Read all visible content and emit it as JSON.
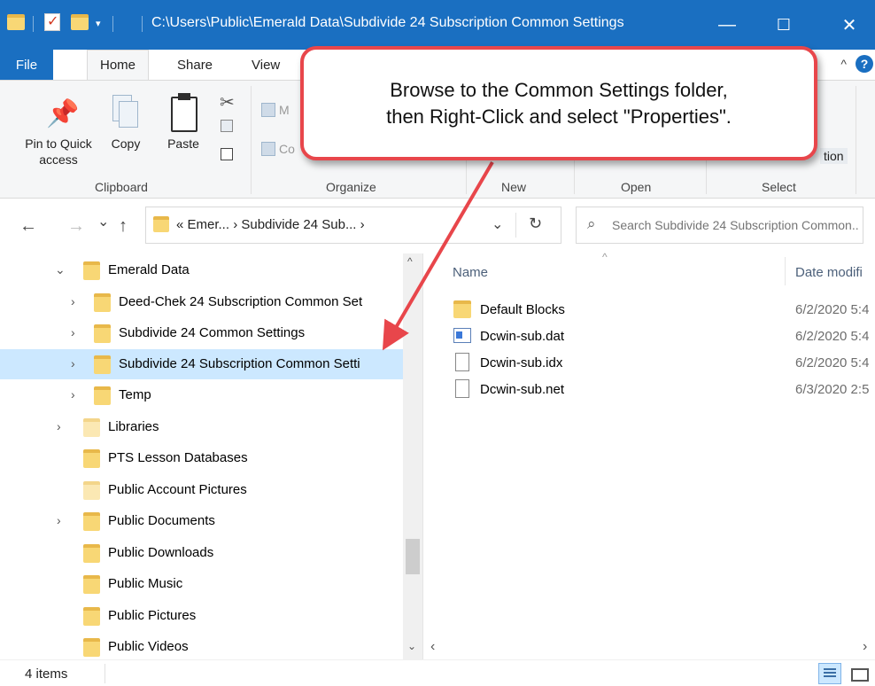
{
  "window": {
    "title": "C:\\Users\\Public\\Emerald Data\\Subdivide 24 Subscription Common Settings",
    "minimize_glyph": "—",
    "maximize_glyph": "☐",
    "close_glyph": "✕"
  },
  "ribbon_tabs": [
    "File",
    "Home",
    "Share",
    "View"
  ],
  "ribbon": {
    "clipboard": {
      "pin_label": "Pin to Quick\naccess",
      "copy_label": "Copy",
      "paste_label": "Paste",
      "group_label": "Clipboard"
    },
    "organize": {
      "move_label_partial": "M",
      "copy_label_partial": "Co",
      "group_label": "Organize"
    },
    "new_group_label": "New",
    "open_group_label": "Open",
    "select": {
      "group_label": "Select",
      "partial_label": "tion"
    }
  },
  "navigation": {
    "back_glyph": "←",
    "forward_glyph": "→",
    "recent_glyph": "⌄",
    "up_glyph": "↑",
    "address_text": "« Emer... › Subdivide 24 Sub... ›",
    "address_dropdown_glyph": "⌄",
    "refresh_glyph": "↻",
    "search_placeholder": "Search Subdivide 24 Subscription Common..."
  },
  "tree": [
    {
      "label": "Emerald Data",
      "chevron": "⌄"
    },
    {
      "label": "Deed-Chek 24 Subscription Common Set",
      "chevron": "›"
    },
    {
      "label": "Subdivide 24 Common Settings",
      "chevron": "›"
    },
    {
      "label": "Subdivide 24 Subscription Common Setti",
      "chevron": "›"
    },
    {
      "label": "Temp",
      "chevron": "›"
    },
    {
      "label": "Libraries",
      "chevron": "›"
    },
    {
      "label": "PTS Lesson Databases",
      "chevron": ""
    },
    {
      "label": "Public Account Pictures",
      "chevron": ""
    },
    {
      "label": "Public Documents",
      "chevron": "›"
    },
    {
      "label": "Public Downloads",
      "chevron": ""
    },
    {
      "label": "Public Music",
      "chevron": ""
    },
    {
      "label": "Public Pictures",
      "chevron": ""
    },
    {
      "label": "Public Videos",
      "chevron": ""
    }
  ],
  "columns": {
    "name": "Name",
    "date": "Date modifi"
  },
  "files": [
    {
      "name": "Default Blocks",
      "date": "6/2/2020 5:4",
      "icon": "folder-icon"
    },
    {
      "name": "Dcwin-sub.dat",
      "date": "6/2/2020 5:4",
      "icon": "dat-file-icon"
    },
    {
      "name": "Dcwin-sub.idx",
      "date": "6/2/2020 5:4",
      "icon": "blank-file-icon"
    },
    {
      "name": "Dcwin-sub.net",
      "date": "6/3/2020 2:5",
      "icon": "blank-file-icon"
    }
  ],
  "status": {
    "item_count": "4 items"
  },
  "callout": {
    "text": "Browse to the Common Settings folder,\nthen Right-Click and select \"Properties\"."
  },
  "colors": {
    "titlebar": "#1a6fc1",
    "selection": "#cce8ff",
    "folder": "#f8d775",
    "callout_border": "#e8464b"
  }
}
